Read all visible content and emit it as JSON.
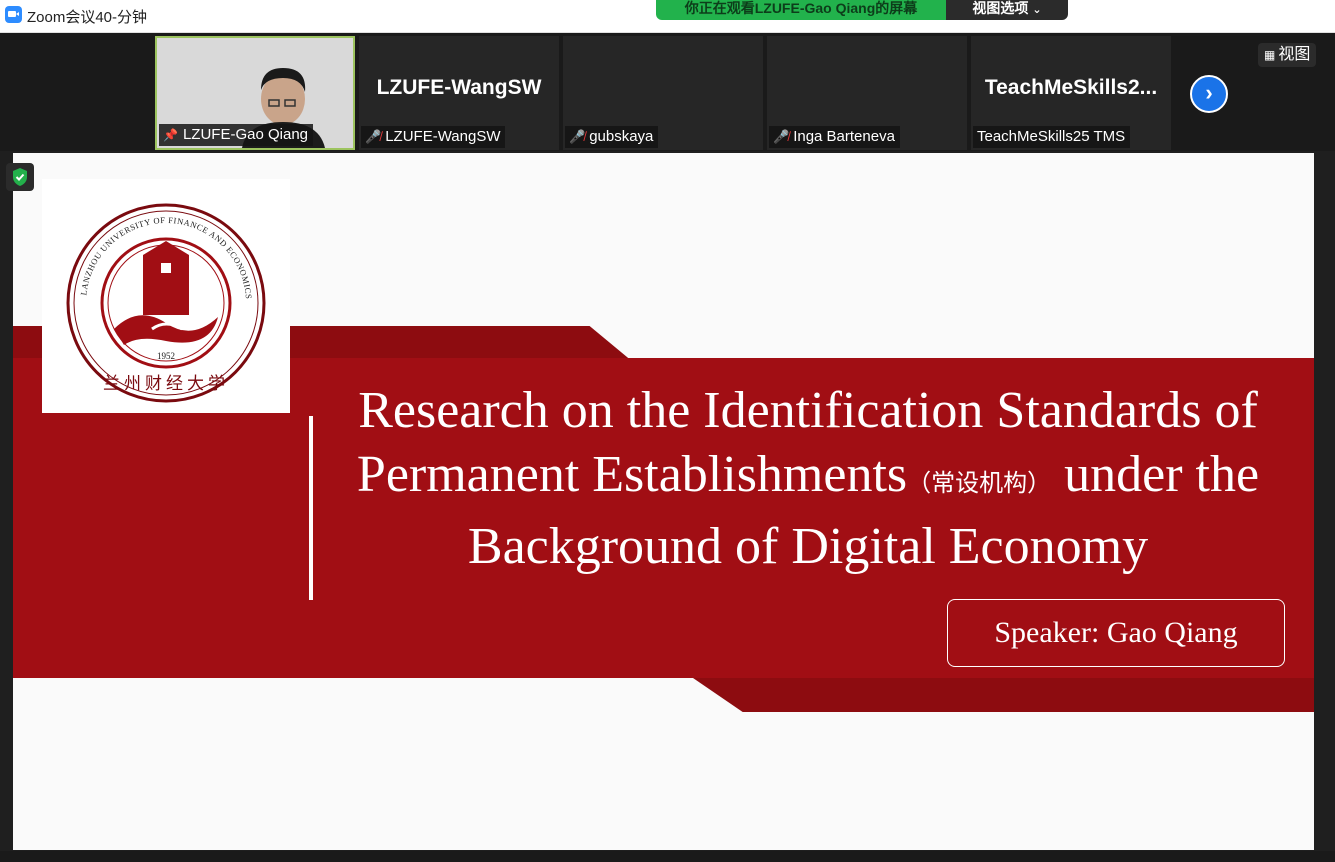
{
  "window": {
    "title": "Zoom会议40-分钟"
  },
  "share_banner": {
    "text": "你正在观看LZUFE-Gao  Qiang的屏幕",
    "view_options_label": "视图选项"
  },
  "participants": [
    {
      "label": "LZUFE-Gao Qiang",
      "big_name": "",
      "video": true,
      "pinned": true,
      "muted": false
    },
    {
      "label": "LZUFE-WangSW",
      "big_name": "LZUFE-WangSW",
      "video": false,
      "muted": true
    },
    {
      "label": "gubskaya",
      "big_name": "",
      "video": false,
      "muted": true
    },
    {
      "label": "Inga Barteneva",
      "big_name": "",
      "video": false,
      "muted": true
    },
    {
      "label": "TeachMeSkills25 TMS",
      "big_name": "TeachMeSkills2...",
      "video": false,
      "muted": false
    }
  ],
  "view_button_label": "视图",
  "slide": {
    "title_line1": "Research on the Identification Standards of",
    "title_line2_a": "Permanent Establishments",
    "title_line2_cn": "（常设机构）",
    "title_line2_b": "under the",
    "title_line3": "Background of Digital Economy",
    "speaker": "Speaker: Gao Qiang",
    "logo": {
      "university_text": "LANZHOU UNIVERSITY OF FINANCE AND ECONOMICS",
      "year": "1952",
      "chinese": "兰州财经大学"
    }
  },
  "colors": {
    "accent_red": "#a10e14",
    "dark_red": "#8d0c10",
    "zoom_blue": "#2d8cff",
    "banner_green": "#22b24c",
    "muted_red": "#e5393b"
  },
  "icons": [
    "zoom-app-icon",
    "pin-icon",
    "mic-muted-icon",
    "chevron-right-icon",
    "grid-view-icon",
    "shield-check-icon",
    "chevron-down-icon"
  ]
}
